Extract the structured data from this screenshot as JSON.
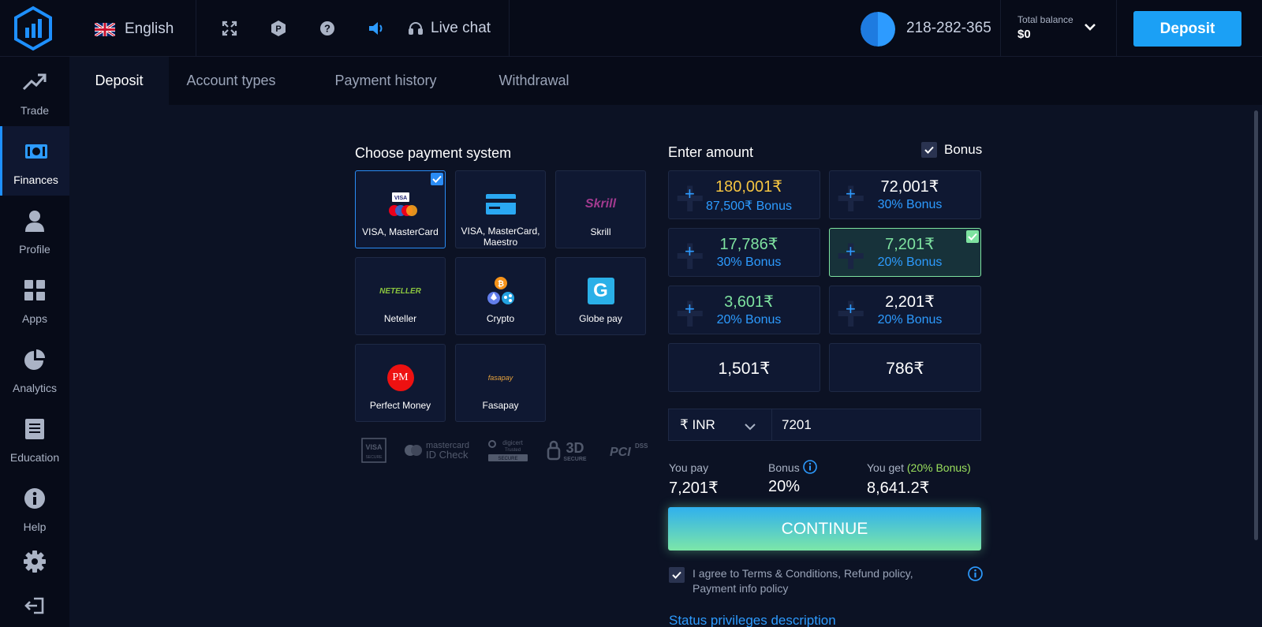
{
  "header": {
    "language": "English",
    "live_chat": "Live chat",
    "account_id": "218-282-365",
    "balance_label": "Total balance",
    "balance_value": "$0",
    "deposit_button": "Deposit"
  },
  "sidebar": {
    "items": [
      {
        "label": "Trade",
        "icon": "trend-up-icon"
      },
      {
        "label": "Finances",
        "icon": "banknote-icon",
        "active": true
      },
      {
        "label": "Profile",
        "icon": "user-icon"
      },
      {
        "label": "Apps",
        "icon": "grid-icon"
      },
      {
        "label": "Analytics",
        "icon": "pie-chart-icon"
      },
      {
        "label": "Education",
        "icon": "book-icon"
      },
      {
        "label": "Help",
        "icon": "info-icon"
      }
    ],
    "bottom_icons": [
      "gear-icon",
      "logout-icon"
    ]
  },
  "tabs": [
    "Deposit",
    "Account types",
    "Payment history",
    "Withdrawal"
  ],
  "payment": {
    "title": "Choose payment system",
    "methods": [
      {
        "name": "VISA, MasterCard",
        "selected": true
      },
      {
        "name": "VISA, MasterCard, Maestro"
      },
      {
        "name": "Skrill",
        "logo_text": "Skrill"
      },
      {
        "name": "Neteller",
        "logo_text": "NETELLER"
      },
      {
        "name": "Crypto"
      },
      {
        "name": "Globe pay",
        "logo_text": "G"
      },
      {
        "name": "Perfect Money",
        "logo_text": "PM"
      },
      {
        "name": "Fasapay",
        "logo_text": "fasapay"
      }
    ],
    "security": {
      "visa": "VISA",
      "visa_sub": "SECURE",
      "mastercard": "mastercard",
      "mastercard_sub": "ID Check",
      "digicert": "digicert",
      "digicert_sub": "Trusted",
      "digicert_badge": "SECURE",
      "threed": "3D",
      "threed_sub": "SECURE",
      "pci": "PCI",
      "pci_sub": "DSS"
    }
  },
  "amount": {
    "title": "Enter amount",
    "bonus_label": "Bonus",
    "presets": [
      {
        "value": "180,001₹",
        "bonus": "87,500₹ Bonus",
        "color": "#f5c542"
      },
      {
        "value": "72,001₹",
        "bonus": "30% Bonus",
        "color": "#ffffff"
      },
      {
        "value": "17,786₹",
        "bonus": "30% Bonus",
        "color": "#7ee2a0"
      },
      {
        "value": "7,201₹",
        "bonus": "20% Bonus",
        "color": "#7ee2a0",
        "selected": true
      },
      {
        "value": "3,601₹",
        "bonus": "20% Bonus",
        "color": "#7ee2a0"
      },
      {
        "value": "2,201₹",
        "bonus": "20% Bonus",
        "color": "#ffffff"
      },
      {
        "value": "1,501₹"
      },
      {
        "value": "786₹"
      }
    ],
    "currency": "₹ INR",
    "input_value": "7201"
  },
  "summary": {
    "you_pay_label": "You pay",
    "you_pay": "7,201₹",
    "bonus_label": "Bonus",
    "bonus": "20%",
    "you_get_label": "You get",
    "you_get_note": "(20% Bonus)",
    "you_get": "8,641.2₹"
  },
  "continue_label": "CONTINUE",
  "agree_text": "I agree to Terms & Conditions, Refund policy, Payment info policy",
  "status_link": "Status privileges description",
  "colors": {
    "accent": "#1ba0f5",
    "bonus_blue": "#2d9bff",
    "green": "#7ee2a0",
    "gold": "#f5c542"
  }
}
